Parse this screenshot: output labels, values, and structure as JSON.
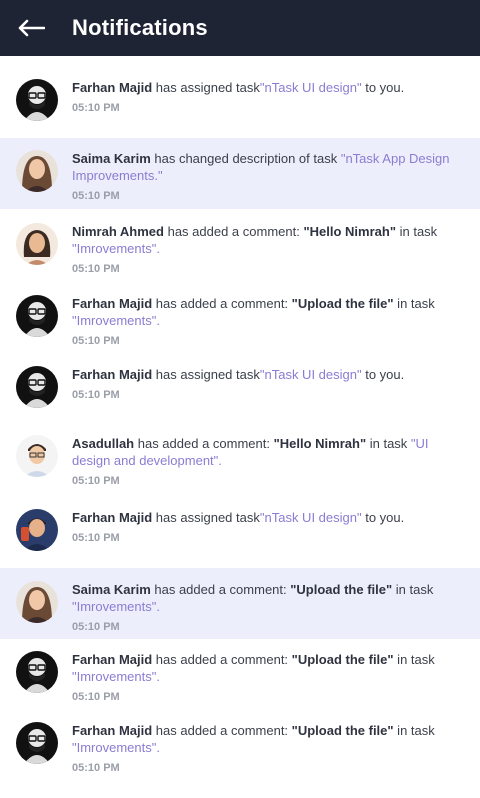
{
  "header": {
    "title": "Notifications",
    "back_icon": "arrow-left-icon"
  },
  "notifications": [
    {
      "name": "Farhan Majid",
      "action": " has assigned task",
      "quote": "",
      "middle": "",
      "link": "\"nTask UI design\"",
      "tail": " to you.",
      "time": "05:10 PM",
      "highlight": false,
      "avatar": "dark"
    },
    {
      "name": "Saima Karim",
      "action": "  has changed description of task ",
      "quote": "",
      "middle": "",
      "link": "\"nTask App Design Improvements.\"",
      "tail": "",
      "time": "05:10 PM",
      "highlight": true,
      "avatar": "woman1"
    },
    {
      "name": "Nimrah Ahmed",
      "action": " has added a comment: ",
      "quote": "\"Hello Nimrah\"",
      "middle": " in task ",
      "link": "\"Imrovements\".",
      "tail": "",
      "time": "05:10 PM",
      "highlight": false,
      "avatar": "woman2"
    },
    {
      "name": "Farhan Majid",
      "action": " has added a comment: ",
      "quote": "\"Upload the file\"",
      "middle": " in task ",
      "link": "\"Imrovements\".",
      "tail": "",
      "time": "05:10 PM",
      "highlight": false,
      "avatar": "dark"
    },
    {
      "name": "Farhan Majid",
      "action": " has assigned task",
      "quote": "",
      "middle": "",
      "link": "\"nTask UI design\"",
      "tail": " to you.",
      "time": "05:10 PM",
      "highlight": false,
      "avatar": "dark"
    },
    {
      "name": "Asadullah",
      "action": " has added a comment: ",
      "quote": "\"Hello Nimrah\"",
      "middle": " in task ",
      "link": "\"UI design and development\".",
      "tail": "",
      "time": "05:10 PM",
      "highlight": false,
      "avatar": "man1"
    },
    {
      "name": "Farhan Majid",
      "action": " has assigned task",
      "quote": "",
      "middle": "",
      "link": "\"nTask UI design\"",
      "tail": " to you.",
      "time": "05:10 PM",
      "highlight": false,
      "avatar": "man2"
    },
    {
      "name": "Saima Karim",
      "action": " has added a comment: ",
      "quote": "\"Upload the file\"",
      "middle": " in task ",
      "link": "\"Imrovements\".",
      "tail": "",
      "time": "05:10 PM",
      "highlight": true,
      "avatar": "woman1"
    },
    {
      "name": "Farhan Majid",
      "action": " has added a comment: ",
      "quote": "\"Upload the file\"",
      "middle": " in task ",
      "link": "\"Imrovements\".",
      "tail": "",
      "time": "05:10 PM",
      "highlight": false,
      "avatar": "dark"
    },
    {
      "name": "Farhan Majid",
      "action": " has added a comment: ",
      "quote": "\"Upload the file\"",
      "middle": " in task ",
      "link": "\"Imrovements\".",
      "tail": "",
      "time": "05:10 PM",
      "highlight": false,
      "avatar": "dark"
    }
  ],
  "colors": {
    "header_bg": "#1f2434",
    "highlight_bg": "#eceffb",
    "link": "#8a7cd3",
    "time": "#9a9ea8"
  }
}
